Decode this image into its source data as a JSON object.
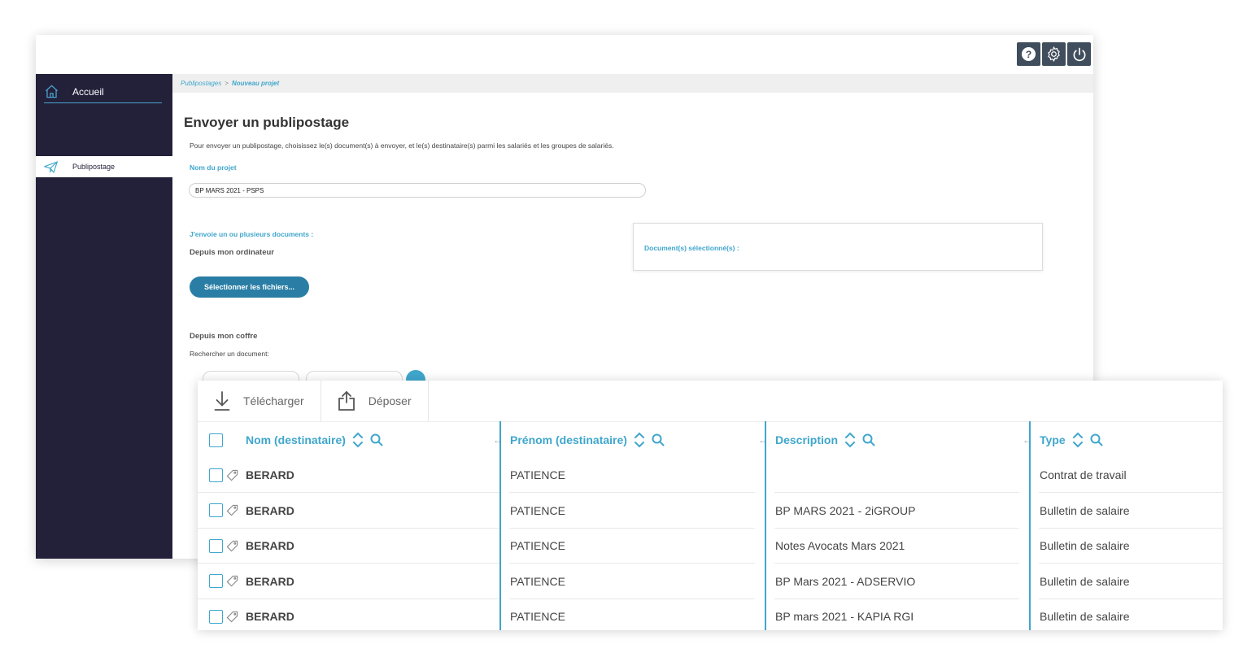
{
  "header": {
    "help_icon": "help-icon",
    "settings_icon": "gear-icon",
    "power_icon": "power-icon"
  },
  "sidebar": {
    "home_label": "Accueil",
    "active_item_label": "Publipostage"
  },
  "breadcrumb": {
    "parent": "Publipostages",
    "separator": ">",
    "current": "Nouveau projet"
  },
  "main": {
    "title": "Envoyer un publipostage",
    "description": "Pour envoyer un publipostage, choisissez le(s) document(s) à envoyer, et le(s) destinataire(s) parmi les salariés et les groupes de salariés.",
    "project_name_label": "Nom du projet",
    "project_name_value": "BP MARS 2021 - PSPS",
    "send_docs_label": "J'envoie un ou plusieurs documents :",
    "from_computer_label": "Depuis mon ordinateur",
    "select_files_button": "Sélectionner les fichiers...",
    "selected_docs_label": "Document(s) sélectionné(s) :",
    "from_vault_label": "Depuis mon coffre",
    "search_doc_label": "Rechercher un document:"
  },
  "panel": {
    "toolbar": {
      "download_label": "Télécharger",
      "upload_label": "Déposer"
    },
    "columns": [
      "Nom (destinataire)",
      "Prénom (destinataire)",
      "Description",
      "Type"
    ],
    "rows": [
      {
        "nom": "BERARD",
        "prenom": "PATIENCE",
        "description": "",
        "type": "Contrat de travail"
      },
      {
        "nom": "BERARD",
        "prenom": "PATIENCE",
        "description": "BP MARS 2021 - 2iGROUP",
        "type": "Bulletin de salaire"
      },
      {
        "nom": "BERARD",
        "prenom": "PATIENCE",
        "description": "Notes Avocats Mars 2021",
        "type": "Bulletin de salaire"
      },
      {
        "nom": "BERARD",
        "prenom": "PATIENCE",
        "description": "BP Mars 2021 - ADSERVIO",
        "type": "Bulletin de salaire"
      },
      {
        "nom": "BERARD",
        "prenom": "PATIENCE",
        "description": "BP mars 2021 - KAPIA RGI",
        "type": "Bulletin de salaire"
      }
    ]
  },
  "colors": {
    "accent": "#3fa6cc",
    "sidebar_bg": "#23203a",
    "button_bg": "#2a7ea5",
    "icon_button_bg": "#3f4d5c"
  }
}
